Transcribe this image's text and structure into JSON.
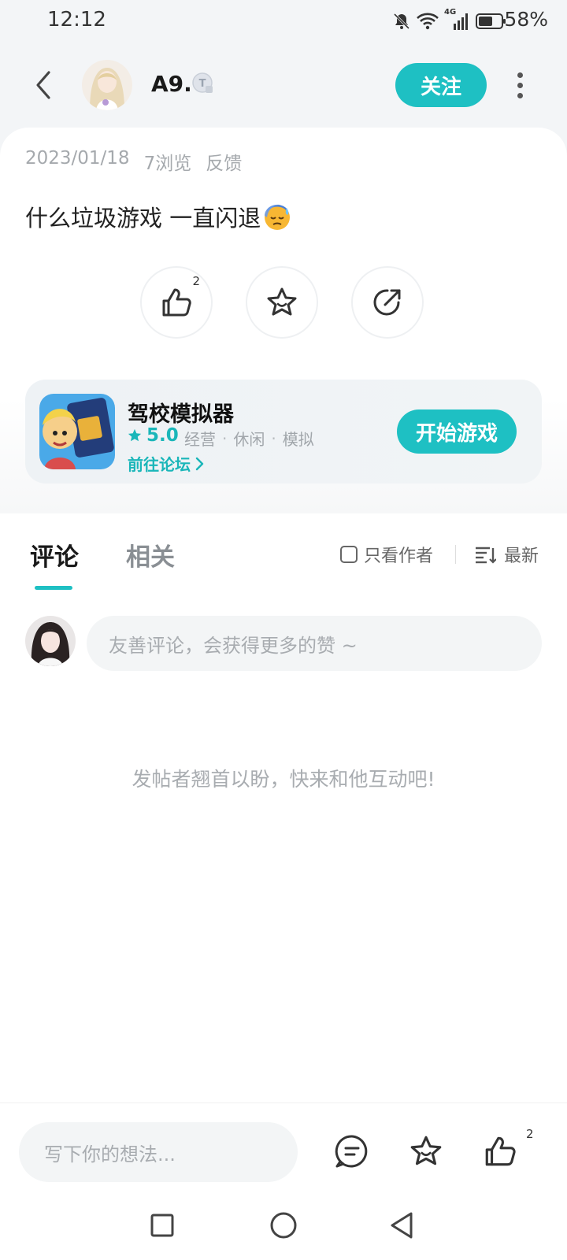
{
  "status_bar": {
    "time": "12:12",
    "battery_percent": "58%",
    "network": "4G"
  },
  "header": {
    "author_name": "A9.",
    "follow_label": "关注"
  },
  "post": {
    "date": "2023/01/18",
    "views": "7浏览",
    "feedback": "反馈",
    "text": "什么垃圾游戏 一直闪退",
    "like_count": "2"
  },
  "game": {
    "name": "驾校模拟器",
    "rating": "5.0",
    "tags": [
      "经营",
      "休闲",
      "模拟"
    ],
    "forum_link": "前往论坛",
    "play_label": "开始游戏"
  },
  "comments": {
    "tabs": [
      {
        "label": "评论",
        "active": true
      },
      {
        "label": "相关",
        "active": false
      }
    ],
    "only_author_label": "只看作者",
    "sort_label": "最新",
    "input_placeholder": "友善评论，会获得更多的赞 ~",
    "empty_hint": "发帖者翘首以盼，快来和他互动吧!"
  },
  "bottom_bar": {
    "input_placeholder": "写下你的想法...",
    "like_count": "2"
  },
  "colors": {
    "accent": "#1ec0c3",
    "accent_text": "#1ab6b9"
  }
}
